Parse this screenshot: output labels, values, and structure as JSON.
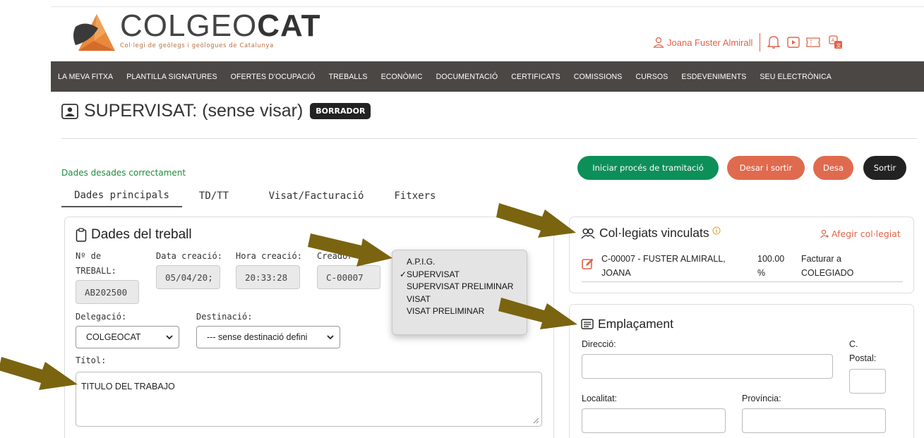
{
  "logo": {
    "word_light": "COLGEO",
    "word_bold": "CAT",
    "subtitle": "Col·legi de geòlegs i geòlogues de Catalunya"
  },
  "user": {
    "name": "Joana Fuster Almirall",
    "icons": [
      "user-icon",
      "bell-icon",
      "video-icon",
      "ticket-icon",
      "translate-icon"
    ]
  },
  "nav": [
    "LA MEVA FITXA",
    "PLANTILLA SIGNATURES",
    "OFERTES D'OCUPACIÓ",
    "TREBALLS",
    "ECONÒMIC",
    "DOCUMENTACIÓ",
    "CERTIFICATS",
    "COMISSIONS",
    "CURSOS",
    "ESDEVENIMENTS",
    "SEU ELECTRÒNICA"
  ],
  "page": {
    "title": "SUPERVISAT: (sense visar)",
    "badge": "BORRADOR",
    "saved_message": "Dades desades correctament"
  },
  "actions": {
    "start": "Iniciar procés de tramitació",
    "save_exit": "Desar i sortir",
    "save": "Desa",
    "exit": "Sortir"
  },
  "tabs": [
    "Dades principals",
    "TD/TT",
    "Visat/Facturació",
    "Fitxers"
  ],
  "work": {
    "title": "Dades del treball",
    "num_label_1": "Nº de",
    "num_label_2": "TREBALL:",
    "num_value": "AB202500",
    "date_label": "Data creació:",
    "date_value": "05/04/20;",
    "time_label": "Hora creació:",
    "time_value": "20:33:28",
    "creator_label": "Creador",
    "creator_value": "C-00007",
    "delegation_label": "Delegació:",
    "delegation_value": "COLGEOCAT",
    "destination_label": "Destinació:",
    "destination_value": "--- sense destinació defini",
    "title_label": "Títol:",
    "title_value": "TITULO DEL TRABAJO"
  },
  "type_menu": {
    "options": [
      "A.P.I.G.",
      "SUPERVISAT",
      "SUPERVISAT PRELIMINAR",
      "VISAT",
      "VISAT PRELIMINAR"
    ],
    "selected": "SUPERVISAT",
    "check": "✓"
  },
  "members": {
    "title": "Col·legiats vinculats",
    "add_label": "Afegir col·legiat",
    "row": {
      "name_1": "C-00007 - FUSTER ALMIRALL,",
      "name_2": "JOANA",
      "percent_1": "100.00",
      "percent_2": "%",
      "billing_1": "Facturar a",
      "billing_2": "COLEGIADO"
    }
  },
  "location": {
    "title": "Emplaçament",
    "address_label": "Direcció:",
    "postal_label_1": "C.",
    "postal_label_2": "Postal:",
    "city_label": "Localitat:",
    "province_label": "Província:"
  },
  "colors": {
    "accent": "#e0634a",
    "nav_bg": "#4b4745",
    "green": "#0d8f59",
    "arrow": "#7a6410"
  }
}
